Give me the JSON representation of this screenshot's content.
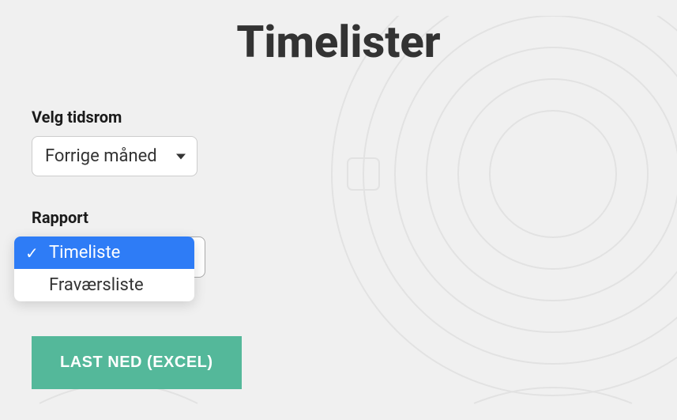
{
  "title": "Timelister",
  "period": {
    "label": "Velg tidsrom",
    "value": "Forrige måned"
  },
  "report": {
    "label": "Rapport",
    "options": [
      {
        "label": "Timeliste",
        "selected": true
      },
      {
        "label": "Fraværsliste",
        "selected": false
      }
    ]
  },
  "download_button": "LAST NED (EXCEL)"
}
